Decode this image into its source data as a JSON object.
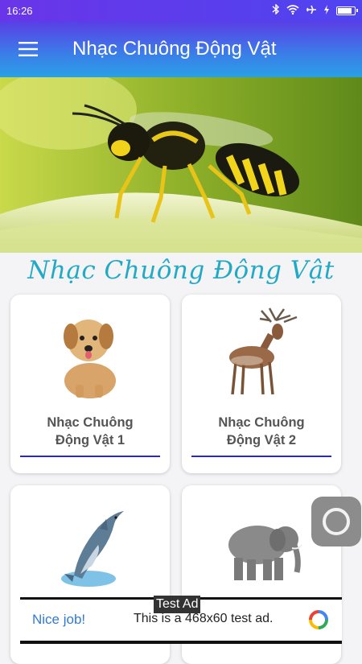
{
  "status_bar": {
    "time": "16:26",
    "icons": [
      "bluetooth-icon",
      "wifi-icon",
      "airplane-icon",
      "charging-icon",
      "battery-icon"
    ],
    "battery_level": 0.9
  },
  "app_bar": {
    "menu_icon": "hamburger-menu-icon",
    "title": "Nhạc Chuông Động Vật"
  },
  "hero": {
    "image": "wasp-on-grass-photo"
  },
  "section_title": "Nhạc Chuông Động Vật",
  "cards": [
    {
      "image": "dog-icon",
      "line1": "Nhạc Chuông",
      "line2": "Động Vật 1"
    },
    {
      "image": "deer-icon",
      "line1": "Nhạc Chuông",
      "line2": "Động Vật 2"
    },
    {
      "image": "dolphin-icon",
      "line1": "",
      "line2": ""
    },
    {
      "image": "elephant-icon",
      "line1": "",
      "line2": ""
    }
  ],
  "floating_button": {
    "icon": "assistive-touch-icon"
  },
  "ad": {
    "tag": "Test Ad",
    "nice_job": "Nice job!",
    "text": "This is a 468x60 test ad.",
    "logo": "adchoices-logo-icon"
  },
  "colors": {
    "app_bar_start": "#5a3ee6",
    "app_bar_end": "#2aa0e6",
    "section_title": "#22a9c6",
    "card_underline": "#2a2ab8",
    "ad_link": "#2f7ad8"
  }
}
